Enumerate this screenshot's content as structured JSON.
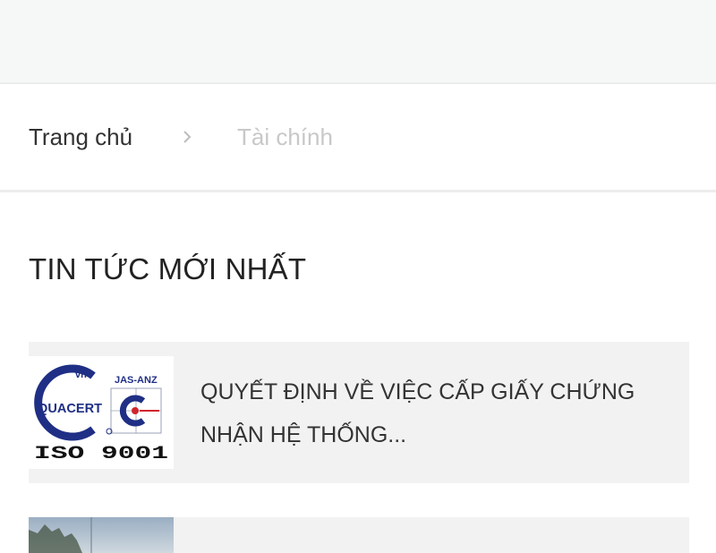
{
  "breadcrumb": {
    "home_label": "Trang chủ",
    "current_label": "Tài chính"
  },
  "section": {
    "title": "TIN TỨC MỚI NHẤT"
  },
  "news": [
    {
      "title": "QUYẾT ĐỊNH VỀ VIỆC CẤP GIẤY CHỨNG NHẬN HỆ THỐNG...",
      "thumbnail": {
        "logo_text": "QUACERT",
        "badge_text": "JAS-ANZ",
        "cert_text": "ISO 9001",
        "small_text": "vn"
      }
    },
    {
      "title": ""
    }
  ],
  "colors": {
    "topbar_bg": "#f6f7f7",
    "card_bg": "#f2f2f2",
    "logo_blue": "#1f2f85",
    "logo_red": "#d0242c"
  }
}
